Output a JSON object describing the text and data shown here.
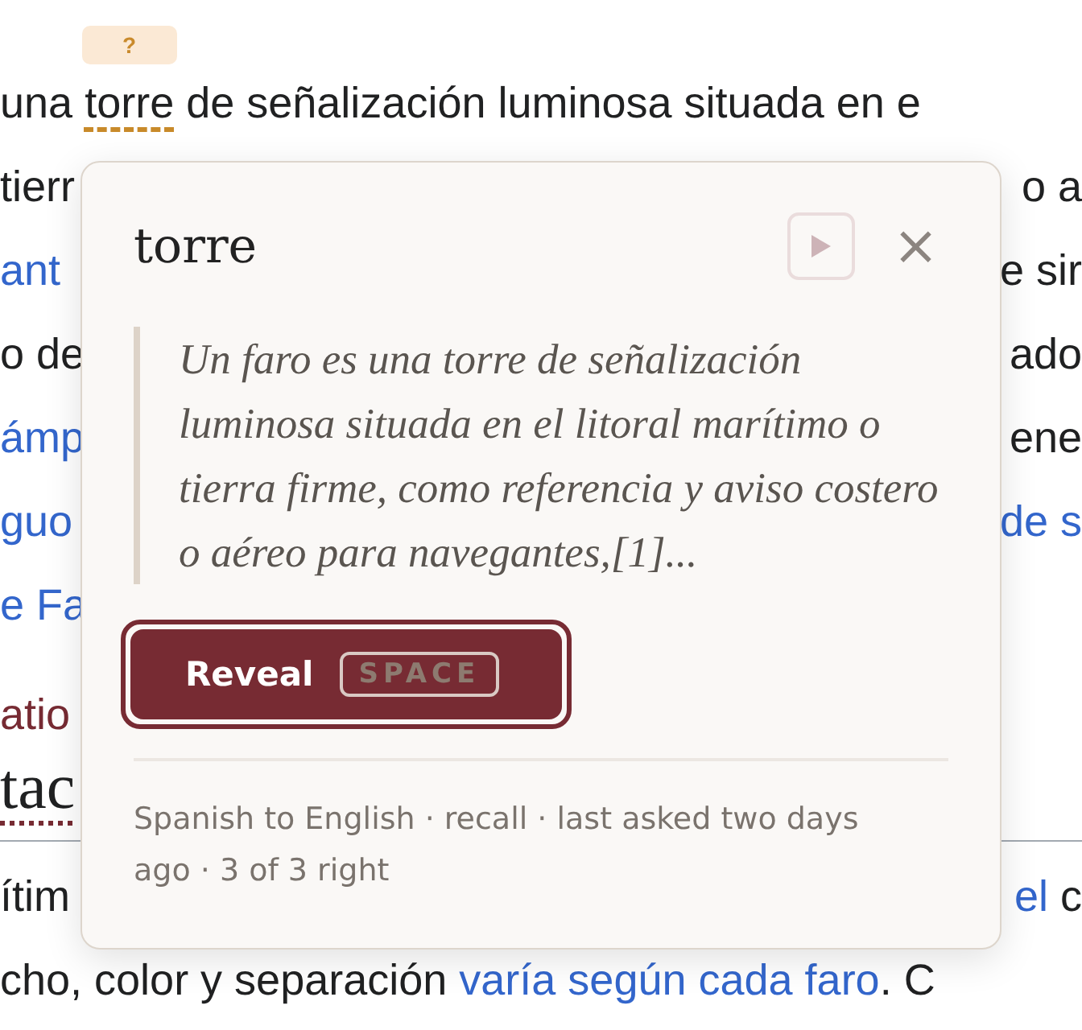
{
  "article": {
    "lines": [
      {
        "kind": "text",
        "left": [
          {
            "kind": "plain",
            "text": "una "
          },
          {
            "kind": "quiz",
            "text": "torre",
            "badge": "?"
          },
          {
            "kind": "plain",
            "text": " de señalización luminosa situada en e"
          }
        ]
      },
      {
        "kind": "text",
        "left": [
          {
            "kind": "plain",
            "text": "tierr"
          }
        ],
        "right": [
          {
            "kind": "plain",
            "text": "o a"
          }
        ]
      },
      {
        "kind": "text",
        "left": [
          {
            "kind": "link",
            "text": "ant"
          }
        ],
        "right": [
          {
            "kind": "plain",
            "text": "e sir"
          }
        ]
      },
      {
        "kind": "text",
        "left": [
          {
            "kind": "plain",
            "text": "o de"
          }
        ],
        "right": [
          {
            "kind": "plain",
            "text": "ado"
          }
        ]
      },
      {
        "kind": "text",
        "left": [
          {
            "kind": "link",
            "text": "ámp"
          }
        ],
        "right": [
          {
            "kind": "plain",
            "text": "ene"
          }
        ]
      },
      {
        "kind": "text",
        "left": [
          {
            "kind": "link",
            "text": "guo"
          }
        ],
        "right": [
          {
            "kind": "link",
            "text": "de s"
          }
        ]
      },
      {
        "kind": "text",
        "left": [
          {
            "kind": "link",
            "text": "e Fa"
          }
        ]
      },
      {
        "kind": "label",
        "left": [
          {
            "kind": "plain",
            "text": "atio"
          }
        ]
      },
      {
        "kind": "heading",
        "left": [
          {
            "kind": "quiz",
            "text": "tac"
          }
        ]
      },
      {
        "kind": "rule"
      },
      {
        "kind": "text",
        "left": [
          {
            "kind": "plain",
            "text": "ítim"
          }
        ],
        "right": [
          {
            "kind": "link",
            "text": "el"
          },
          {
            "kind": "plain",
            "text": " c"
          }
        ]
      },
      {
        "kind": "text",
        "left": [
          {
            "kind": "plain",
            "text": "cho, color y separación "
          },
          {
            "kind": "link",
            "text": "varía según cada faro"
          },
          {
            "kind": "plain",
            "text": ". C"
          }
        ]
      }
    ]
  },
  "popup": {
    "word": "torre",
    "play": {
      "disabled": true
    },
    "close": "×",
    "quote": "Un faro es una torre de señalización luminosa situada en el litoral marítimo o tierra firme, como referencia y aviso costero o aéreo para navegantes,[1]...",
    "reveal": {
      "label": "Reveal",
      "shortcut": "SPACE"
    },
    "meta": "Spanish to English · recall · last asked two days ago · 3 of 3 right"
  }
}
